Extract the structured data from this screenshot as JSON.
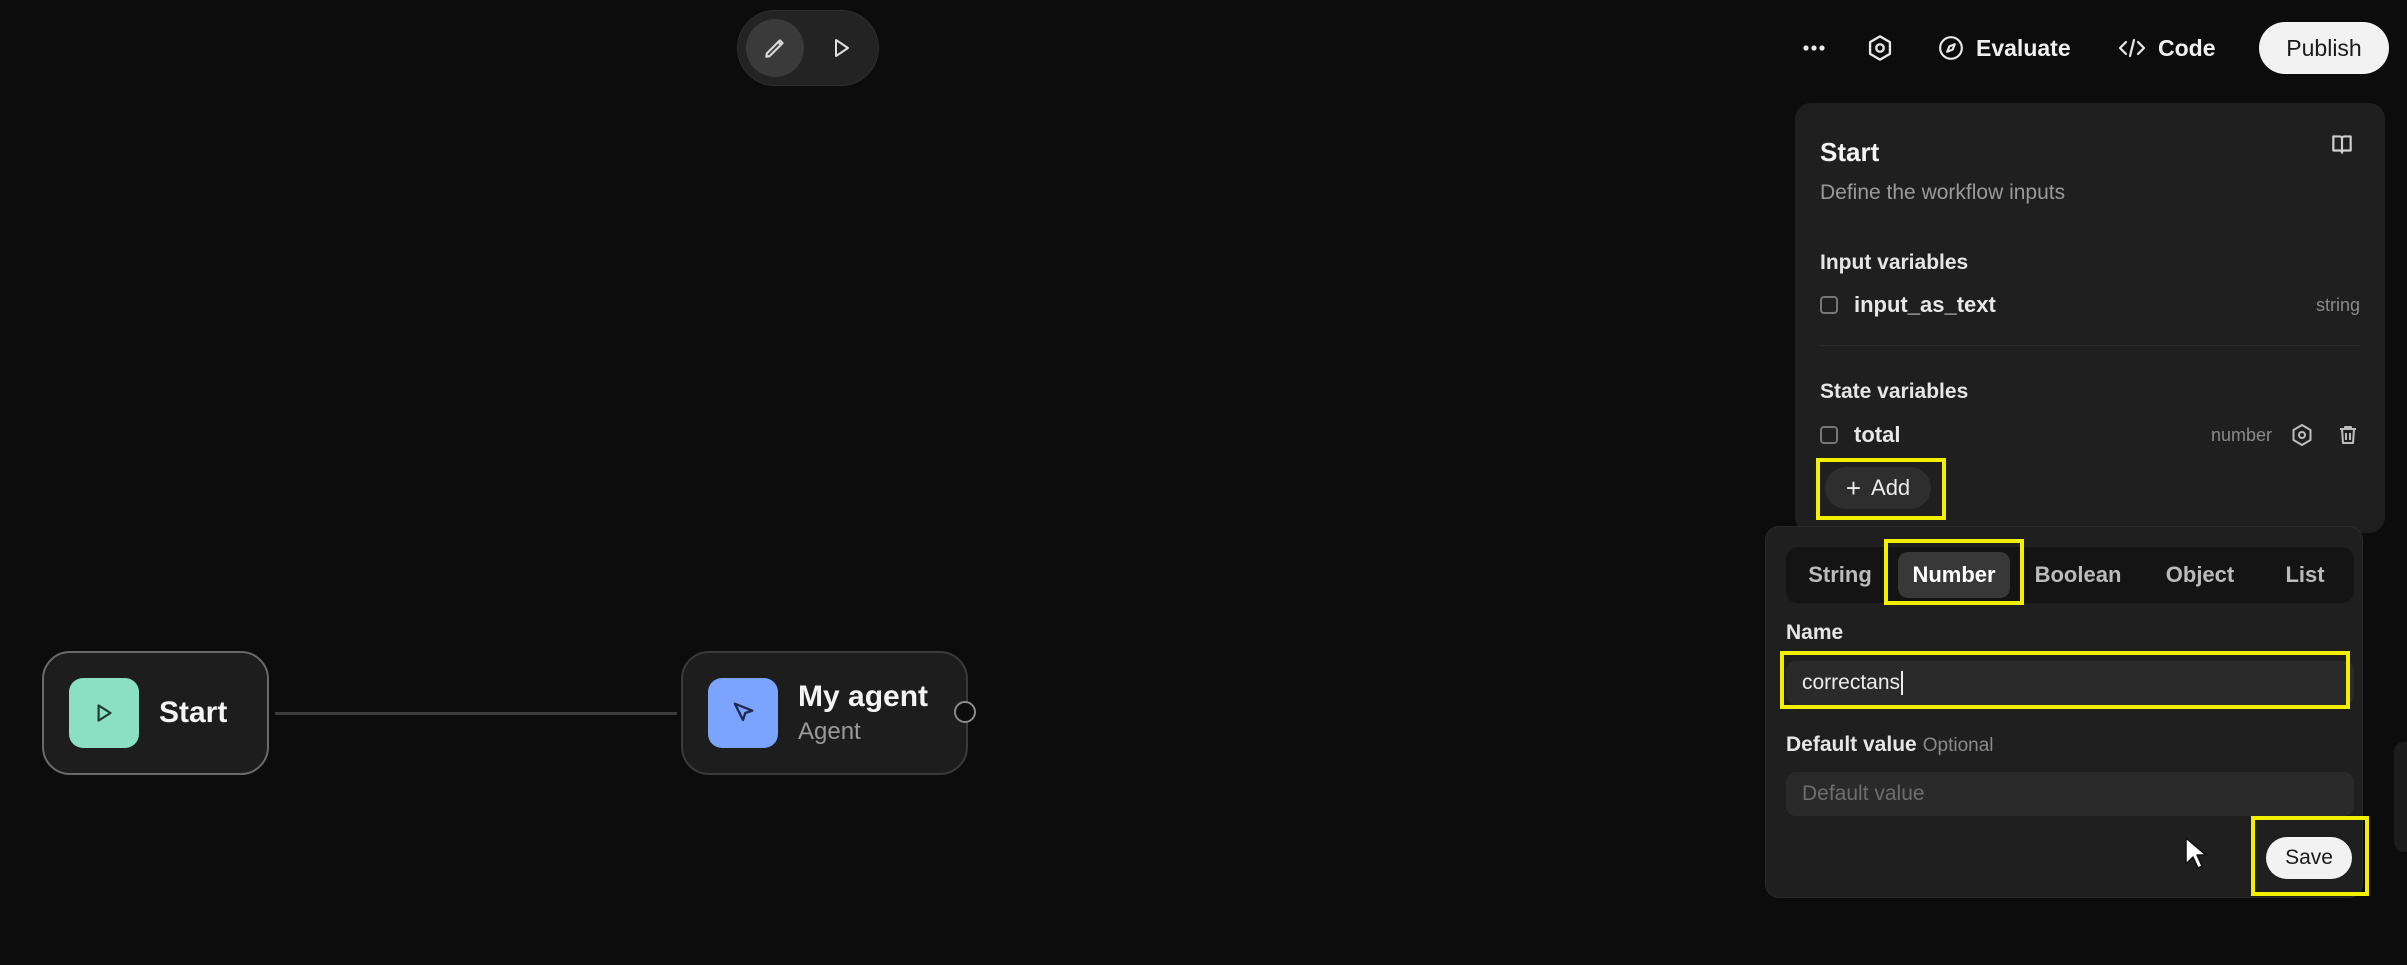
{
  "mode_toggle": {
    "edit_icon": "pencil-icon",
    "run_icon": "play-icon"
  },
  "toolbar": {
    "more_icon": "ellipsis-icon",
    "settings_icon": "gear-icon",
    "evaluate_label": "Evaluate",
    "code_label": "Code",
    "publish_label": "Publish"
  },
  "canvas": {
    "nodes": [
      {
        "title": "Start",
        "icon": "play-icon",
        "color": "#8be0c3"
      },
      {
        "title": "My agent",
        "subtitle": "Agent",
        "icon": "cursor-icon",
        "color": "#7ba4ff"
      }
    ]
  },
  "panel": {
    "title": "Start",
    "description": "Define the workflow inputs",
    "input_section": "Input variables",
    "input_variables": [
      {
        "name": "input_as_text",
        "type": "string"
      }
    ],
    "state_section": "State variables",
    "state_variables": [
      {
        "name": "total",
        "type": "number"
      }
    ],
    "add_label": "Add"
  },
  "popover": {
    "types": [
      "String",
      "Number",
      "Boolean",
      "Object",
      "List"
    ],
    "selected_type": "Number",
    "name_label": "Name",
    "name_value": "correctans",
    "default_label": "Default value",
    "default_optional": "Optional",
    "default_placeholder": "Default value",
    "save_label": "Save"
  },
  "colors": {
    "highlight": "#f2f000",
    "background": "#0c0c0c"
  }
}
